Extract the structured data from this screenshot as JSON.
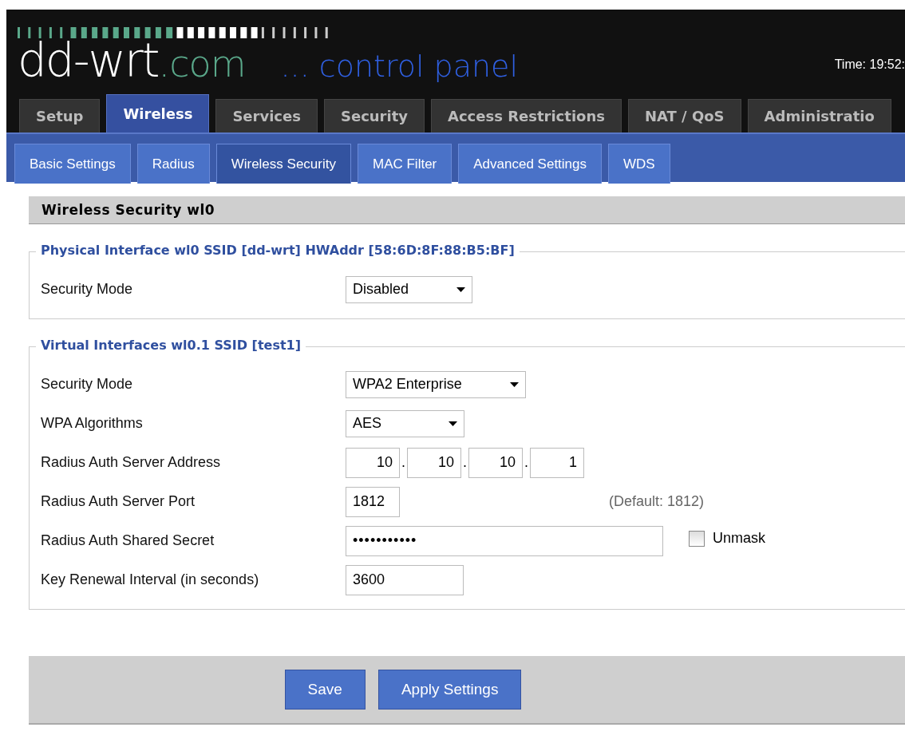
{
  "header": {
    "logo_main": "dd-wrt",
    "logo_suffix": ".com",
    "logo_tagline": "... control panel",
    "time": "Time: 19:52:"
  },
  "tabs": [
    {
      "label": "Setup",
      "selected": false
    },
    {
      "label": "Wireless",
      "selected": true
    },
    {
      "label": "Services",
      "selected": false
    },
    {
      "label": "Security",
      "selected": false
    },
    {
      "label": "Access Restrictions",
      "selected": false
    },
    {
      "label": "NAT / QoS",
      "selected": false
    },
    {
      "label": "Administratio",
      "selected": false
    }
  ],
  "subtabs": [
    {
      "label": "Basic Settings",
      "selected": false
    },
    {
      "label": "Radius",
      "selected": false
    },
    {
      "label": "Wireless Security",
      "selected": true
    },
    {
      "label": "MAC Filter",
      "selected": false
    },
    {
      "label": "Advanced Settings",
      "selected": false
    },
    {
      "label": "WDS",
      "selected": false
    }
  ],
  "section_title": "Wireless Security wl0",
  "fieldsets": [
    {
      "legend": "Physical Interface wl0 SSID [dd-wrt] HWAddr [58:6D:8F:88:B5:BF]",
      "rows": [
        {
          "kind": "select",
          "label": "Security Mode",
          "value": "Disabled"
        }
      ]
    },
    {
      "legend": "Virtual Interfaces wl0.1 SSID [test1]",
      "rows": [
        {
          "kind": "select",
          "label": "Security Mode",
          "value": "WPA2 Enterprise"
        },
        {
          "kind": "select",
          "label": "WPA Algorithms",
          "value": "AES"
        },
        {
          "kind": "ip",
          "label": "Radius Auth Server Address",
          "octets": [
            "10",
            "10",
            "10",
            "1"
          ],
          "separators": [
            ".",
            ".",
            "."
          ]
        },
        {
          "kind": "text",
          "label": "Radius Auth Server Port",
          "value": "1812",
          "hint": "(Default: 1812)"
        },
        {
          "kind": "password",
          "label": "Radius Auth Shared Secret",
          "value": "•••••••••••",
          "checkbox": {
            "label": "Unmask",
            "checked": false
          }
        },
        {
          "kind": "text",
          "label": "Key Renewal Interval (in seconds)",
          "value": "3600"
        }
      ]
    }
  ],
  "buttons": [
    "Save",
    "Apply Settings"
  ]
}
